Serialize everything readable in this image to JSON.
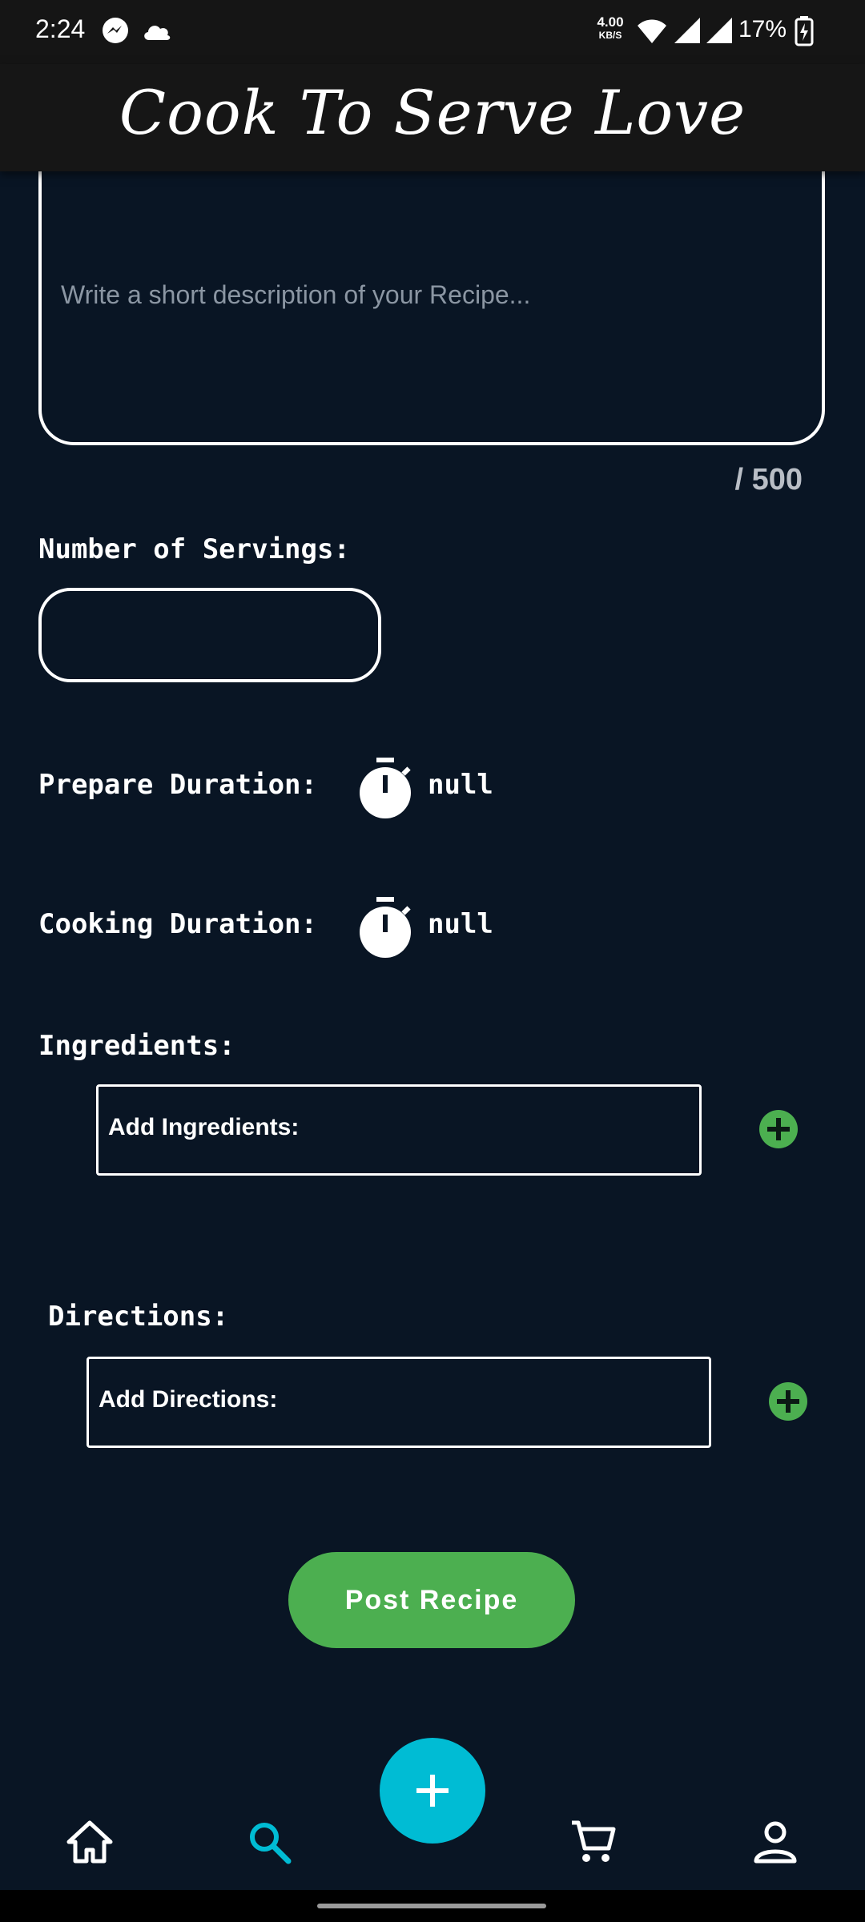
{
  "status_bar": {
    "time": "2:24",
    "net_speed_value": "4.00",
    "net_speed_unit": "KB/S",
    "battery_percent": "17%"
  },
  "header": {
    "title": "Cook To Serve Love"
  },
  "description": {
    "placeholder": "Write a short description of your Recipe...",
    "counter": "/ 500"
  },
  "servings": {
    "label": "Number of Servings:"
  },
  "prepare": {
    "label": "Prepare Duration:",
    "value": "null"
  },
  "cooking": {
    "label": "Cooking Duration:",
    "value": "null"
  },
  "ingredients": {
    "label": "Ingredients:",
    "field_label": "Add Ingredients:"
  },
  "directions": {
    "label": "Directions:",
    "field_label": "Add Directions:"
  },
  "actions": {
    "post_label": "Post Recipe"
  },
  "bottom_nav": {
    "items": [
      {
        "icon": "home-icon"
      },
      {
        "icon": "search-icon",
        "active": true
      },
      {
        "icon": "add-icon"
      },
      {
        "icon": "cart-icon"
      },
      {
        "icon": "profile-icon"
      }
    ]
  },
  "colors": {
    "background": "#091524",
    "accent_green": "#4caf50",
    "accent_cyan": "#00bcd4"
  }
}
